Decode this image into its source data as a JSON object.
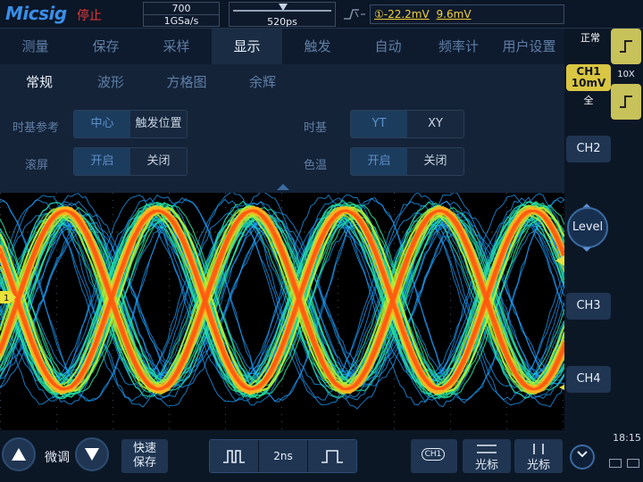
{
  "header": {
    "logo": "Micsig",
    "run_state": "停止",
    "memory_depth": "700",
    "sample_rate": "1GSa/s",
    "time_offset": "520ps",
    "trigger_level": "①-22.2mV",
    "trigger_level2": "9.6mV"
  },
  "menu": {
    "tabs": [
      {
        "label": "测量"
      },
      {
        "label": "保存"
      },
      {
        "label": "采样"
      },
      {
        "label": "显示"
      },
      {
        "label": "触发"
      },
      {
        "label": "自动"
      },
      {
        "label": "频率计"
      },
      {
        "label": "用户设置"
      }
    ],
    "active_tab": "显示",
    "subtabs": [
      {
        "label": "常规"
      },
      {
        "label": "波形"
      },
      {
        "label": "方格图"
      },
      {
        "label": "余辉"
      }
    ],
    "active_subtab": "常规"
  },
  "settings": {
    "timebase_ref": {
      "label": "时基参考",
      "options": [
        "中心",
        "触发位置"
      ],
      "selected": "中心"
    },
    "timebase": {
      "label": "时基",
      "options": [
        "YT",
        "XY"
      ],
      "selected": "YT"
    },
    "scroll": {
      "label": "滚屏",
      "options": [
        "开启",
        "关闭"
      ],
      "selected": "开启"
    },
    "color_temp": {
      "label": "色温",
      "options": [
        "开启",
        "关闭"
      ],
      "selected": "开启"
    }
  },
  "right_panel": {
    "mode": "正常",
    "probe": "10X",
    "ch1_name": "CH1",
    "ch1_scale": "10mV",
    "ch1_coupling": "全",
    "ch2": "CH2",
    "level": "Level",
    "ch3": "CH3",
    "ch4": "CH4",
    "clock": "18:15"
  },
  "scope": {
    "ch1_marker": "1",
    "ch1_color": "#e8e23a",
    "persistence_colors": [
      "#1aa0ff",
      "#24e0a0",
      "#b8f030",
      "#ffb020",
      "#ff5a10"
    ]
  },
  "bottom": {
    "fine_label": "微调",
    "quick_save": [
      "快速",
      "保存"
    ],
    "timebase_value": "2ns",
    "ch1_label": "CH1",
    "cursor_label_1": "光标",
    "cursor_label_2": "光标"
  }
}
